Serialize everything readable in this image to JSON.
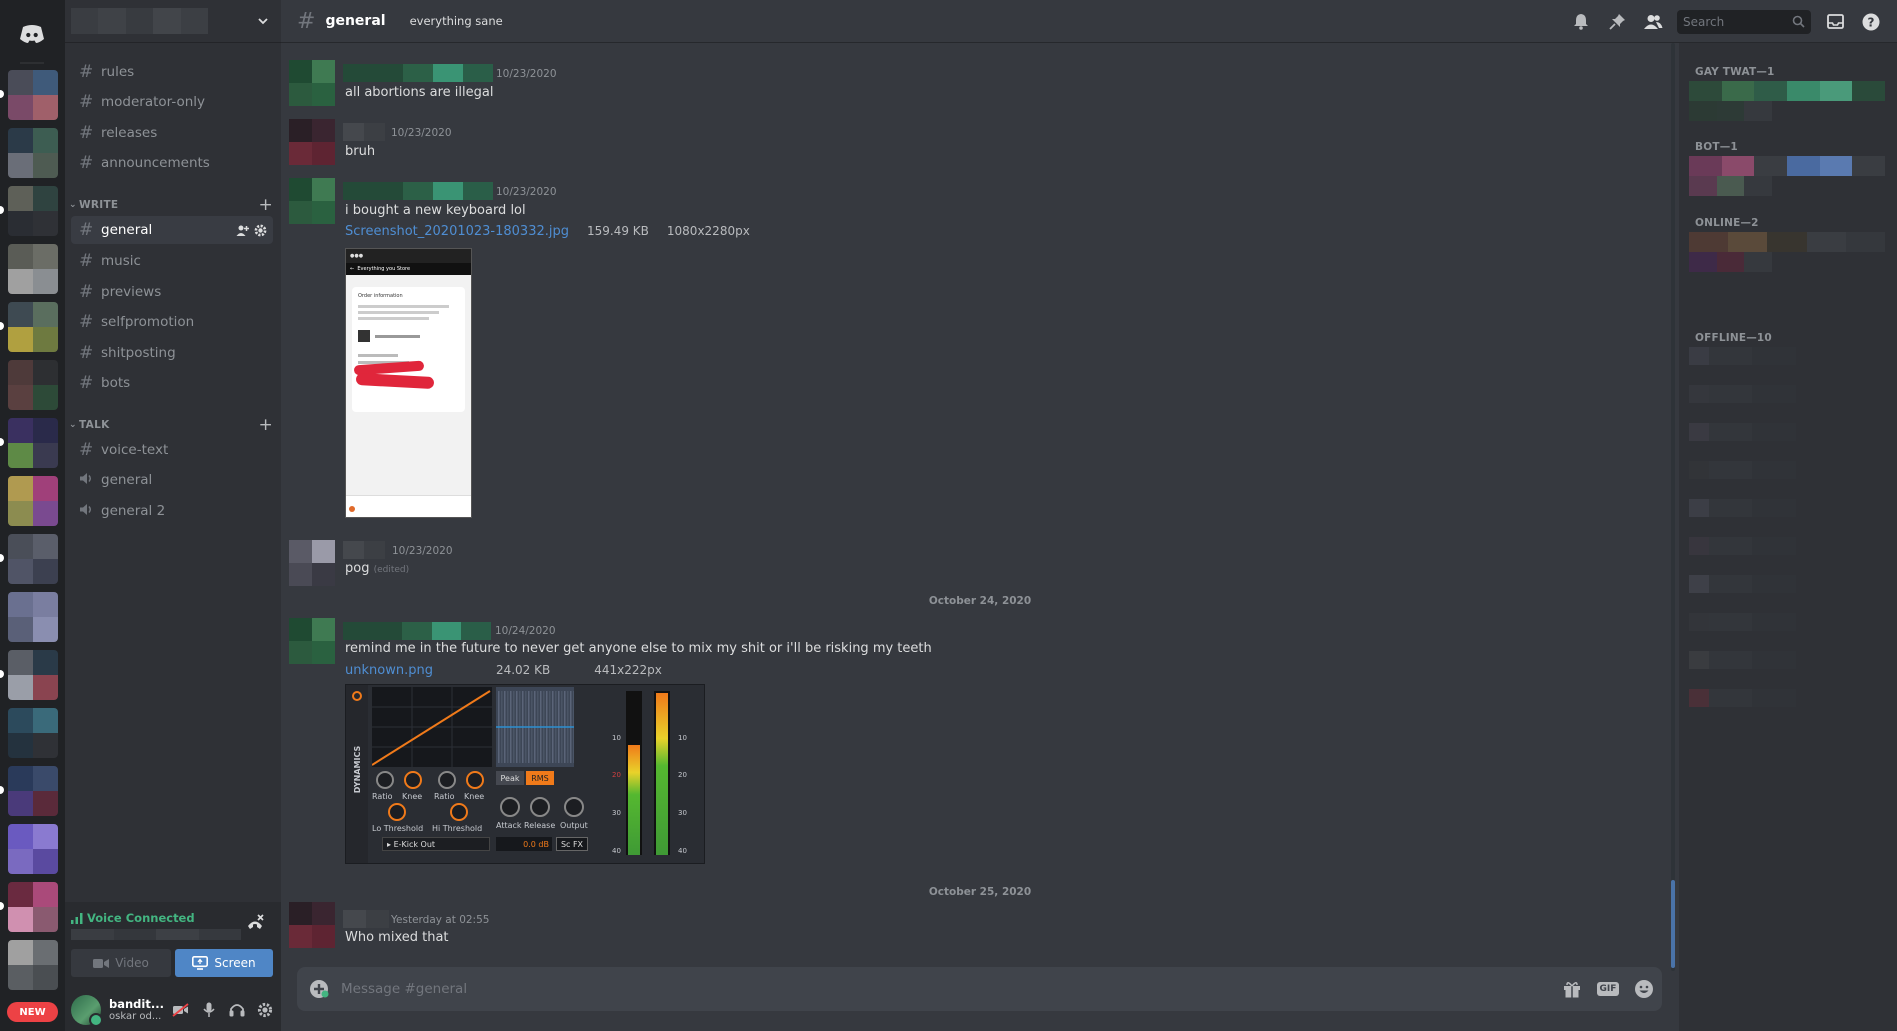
{
  "colors": {
    "accent_blue": "#4f86c6",
    "link_blue": "#4f8ed3",
    "online_green": "#43b581",
    "new_badge_red": "#ed4245",
    "background_main": "#36393f",
    "background_sidebar": "#2f3136",
    "background_rail": "#202225"
  },
  "server_rail": {
    "home_icon": "discord-logo-icon",
    "new_badge": "NEW"
  },
  "sidebar": {
    "top_channels": [
      {
        "name": "rules",
        "icon": "hash-icon"
      },
      {
        "name": "moderator-only",
        "icon": "hash-icon"
      },
      {
        "name": "releases",
        "icon": "hash-icon"
      },
      {
        "name": "announcements",
        "icon": "hash-icon"
      }
    ],
    "categories": [
      {
        "name": "WRITE",
        "channels": [
          {
            "name": "general",
            "icon": "hash-icon",
            "active": true
          },
          {
            "name": "music",
            "icon": "hash-icon"
          },
          {
            "name": "previews",
            "icon": "hash-icon"
          },
          {
            "name": "selfpromotion",
            "icon": "hash-icon"
          },
          {
            "name": "shitposting",
            "icon": "hash-icon"
          },
          {
            "name": "bots",
            "icon": "hash-icon"
          }
        ]
      },
      {
        "name": "TALK",
        "channels": [
          {
            "name": "voice-text",
            "icon": "hash-icon"
          },
          {
            "name": "general",
            "icon": "speaker-icon"
          },
          {
            "name": "general 2",
            "icon": "speaker-icon"
          }
        ]
      }
    ],
    "voice": {
      "status": "Voice Connected",
      "video_label": "Video",
      "screen_label": "Screen"
    },
    "user": {
      "name": "bandit...",
      "subtext": "oskar od..."
    }
  },
  "header": {
    "channel": "general",
    "topic": "everything sane",
    "search_placeholder": "Search"
  },
  "messages": [
    {
      "time": "10/23/2020",
      "text": "all abortions are illegal"
    },
    {
      "time": "10/23/2020",
      "text": "bruh"
    },
    {
      "time": "10/23/2020",
      "text": "i bought a new keyboard lol",
      "attachment": {
        "file": "Screenshot_20201023-180332.jpg",
        "size": "159.49 KB",
        "dims": "1080x2280px"
      }
    },
    {
      "time": "10/23/2020",
      "text": "pog",
      "edited": "(edited)"
    },
    {
      "divider": "October 24, 2020"
    },
    {
      "time": "10/24/2020",
      "text": "remind me in the future to never get anyone else to mix my shit or i'll be risking my teeth",
      "attachment": {
        "file": "unknown.png",
        "size": "24.02 KB",
        "dims": "441x222px"
      }
    },
    {
      "divider": "October 25, 2020"
    },
    {
      "time": "Yesterday at 02:55",
      "text": "Who mixed that"
    }
  ],
  "daw": {
    "side_label": "DYNAMICS",
    "knobs_left": [
      "Ratio",
      "Knee"
    ],
    "knobs_right": [
      "Ratio",
      "Knee"
    ],
    "lo_threshold": "Lo Threshold",
    "hi_threshold": "Hi Threshold",
    "peak": "Peak",
    "rms": "RMS",
    "attack": "Attack",
    "release": "Release",
    "output": "Output",
    "preset": "E-Kick Out",
    "db_value": "0.0 dB",
    "sc_fx": "Sc FX",
    "meter_ticks": [
      "10",
      "20",
      "30",
      "40"
    ]
  },
  "phone": {
    "title": "Everything you Store",
    "order_heading": "Order information"
  },
  "composer": {
    "placeholder": "Message #general",
    "gif_label": "GIF"
  },
  "members": {
    "categories": [
      "GAY TWAT—1",
      "BOT—1",
      "ONLINE—2",
      "OFFLINE—10"
    ]
  }
}
